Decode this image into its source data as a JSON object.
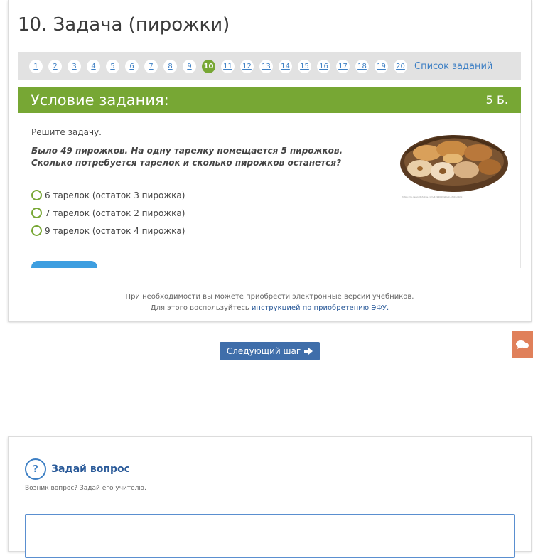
{
  "page": {
    "title": "10. Задача (пирожки)"
  },
  "task_nav": {
    "numbers": [
      "1",
      "2",
      "3",
      "4",
      "5",
      "6",
      "7",
      "8",
      "9",
      "10",
      "11",
      "12",
      "13",
      "14",
      "15",
      "16",
      "17",
      "18",
      "19",
      "20"
    ],
    "active": "10",
    "list_link": "Список заданий"
  },
  "condition": {
    "header": "Условие задания:",
    "score": "5 Б.",
    "instruction": "Решите задачу.",
    "question": "Было 49 пирожков. На одну тарелку помещается 5 пирожков. Сколько потребуется тарелок и сколько пирожков останется?",
    "image_caption": "https://ru.depositphotos.com/4194041/stock-photo.html",
    "options": [
      "6 тарелок (остаток 3 пирожка)",
      "7 тарелок (остаток 2 пирожка)",
      "9 тарелок (остаток 4 пирожка)"
    ]
  },
  "footer": {
    "line1": "При необходимости вы можете приобрести электронные версии учебников.",
    "line2_prefix": "Для этого воспользуйтесь ",
    "line2_link": "инструкцией по приобретению ЭФУ."
  },
  "next_button": {
    "label": "Следующий шаг"
  },
  "ask": {
    "icon_text": "?",
    "title": "Задай вопрос",
    "subtitle": "Возник вопрос? Задай его учителю."
  },
  "colors": {
    "accent_green": "#77a734",
    "link_blue": "#3d7fc4",
    "button_blue": "#3f6eaa",
    "chat_orange": "#e0805a"
  }
}
